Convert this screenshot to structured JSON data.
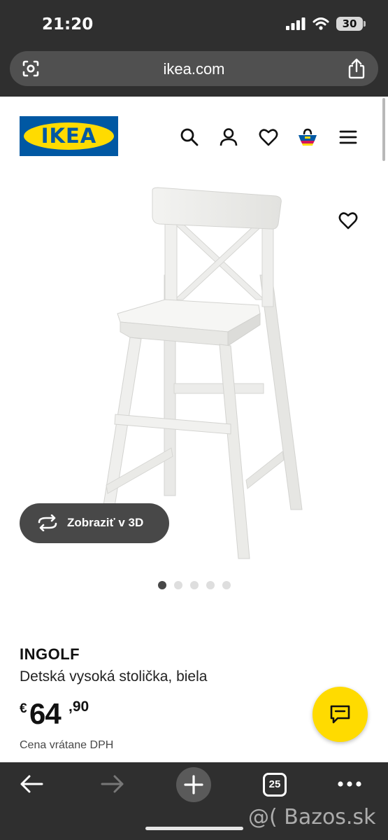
{
  "status_bar": {
    "time": "21:20",
    "battery": "30",
    "icons": [
      "cellular-signal-icon",
      "wifi-icon",
      "battery-icon"
    ]
  },
  "browser": {
    "url": "ikea.com",
    "tabs_count": "25",
    "icons": [
      "lens-icon",
      "share-icon",
      "back-arrow-icon",
      "forward-arrow-icon",
      "new-tab-icon",
      "tabs-icon",
      "more-icon"
    ]
  },
  "header": {
    "logo_text": "IKEA",
    "icons": [
      "search-icon",
      "account-icon",
      "wishlist-heart-icon",
      "shopping-bag-icon",
      "menu-icon"
    ]
  },
  "product": {
    "image_subject": "white children's high chair",
    "view_3d_label": "Zobraziť v 3D",
    "gallery": {
      "total": 5,
      "active_index": 0
    },
    "name": "INGOLF",
    "description": "Detská vysoká stolička, biela",
    "price": {
      "currency": "€",
      "integer": "64",
      "decimal": ",90"
    },
    "vat_note": "Cena vrátane DPH"
  },
  "watermark": "@( Bazos.sk",
  "colors": {
    "ikea_blue": "#0058a3",
    "ikea_yellow": "#ffdb00",
    "chrome_dark": "#2f2f2f",
    "button_dark": "#484848"
  }
}
